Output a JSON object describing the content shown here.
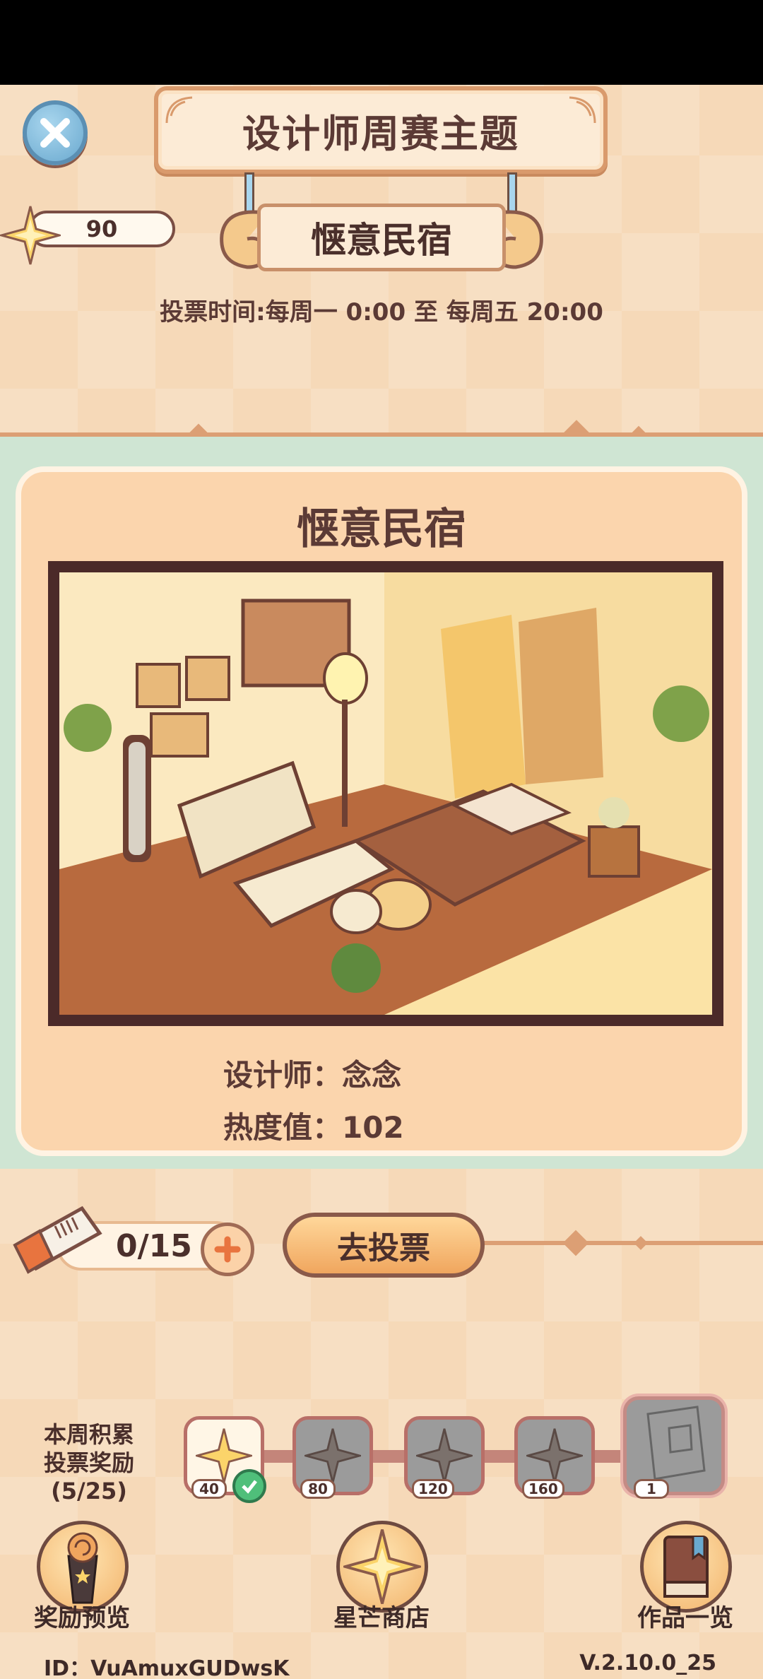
{
  "header": {
    "title": "设计师周赛主题",
    "theme": "惬意民宿",
    "vote_time": "投票时间:每周一 0:00 至 每周五 20:00"
  },
  "currency": {
    "icon": "star-icon",
    "value": "90"
  },
  "card": {
    "title": "惬意民宿",
    "designer_line": "设计师：念念",
    "heat_line": "热度值：102"
  },
  "tickets": {
    "count": "0/15",
    "vote_button": "去投票"
  },
  "rewards": {
    "label_line1": "本周积累",
    "label_line2": "投票奖励",
    "label_line3": "(5/25)",
    "nodes": [
      {
        "value": "40",
        "state": "claimed"
      },
      {
        "value": "80",
        "state": "locked"
      },
      {
        "value": "120",
        "state": "locked"
      },
      {
        "value": "160",
        "state": "locked"
      }
    ],
    "final": {
      "value": "1",
      "state": "locked"
    }
  },
  "nav": {
    "preview": "奖励预览",
    "shop": "星芒商店",
    "gallery": "作品一览"
  },
  "footer": {
    "id": "ID：VuAmuxGUDwsK",
    "version": "V.2.10.0_25"
  },
  "colors": {
    "accent": "#dc9f74",
    "text": "#5b3a35",
    "card": "#fbd5ad",
    "mint": "#cfe5d3"
  }
}
